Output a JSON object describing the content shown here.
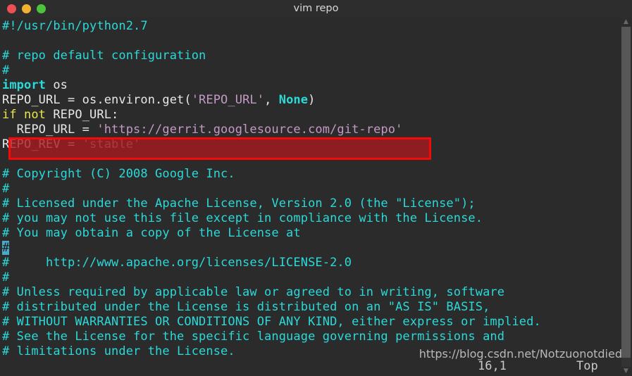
{
  "window": {
    "title": "vim repo",
    "traffic_lights": [
      {
        "name": "close",
        "color": "#ed4f54"
      },
      {
        "name": "minimize",
        "color": "#f0b132"
      },
      {
        "name": "maximize",
        "color": "#4cc43c"
      }
    ]
  },
  "editor": {
    "filename": "repo",
    "lines": [
      {
        "n": 1,
        "segments": [
          {
            "t": "#!/usr/bin/python2.7",
            "c": "comment"
          }
        ]
      },
      {
        "n": 2,
        "segments": [
          {
            "t": "",
            "c": "blank"
          }
        ]
      },
      {
        "n": 3,
        "segments": [
          {
            "t": "# repo default configuration",
            "c": "comment"
          }
        ]
      },
      {
        "n": 4,
        "segments": [
          {
            "t": "#",
            "c": "comment"
          }
        ]
      },
      {
        "n": 5,
        "segments": [
          {
            "t": "import",
            "c": "const"
          },
          {
            "t": " os",
            "c": "plain"
          }
        ]
      },
      {
        "n": 6,
        "segments": [
          {
            "t": "REPO_URL = os.environ.get(",
            "c": "plain"
          },
          {
            "t": "'REPO_URL'",
            "c": "string"
          },
          {
            "t": ", ",
            "c": "plain"
          },
          {
            "t": "None",
            "c": "const"
          },
          {
            "t": ")",
            "c": "plain"
          }
        ]
      },
      {
        "n": 7,
        "segments": [
          {
            "t": "if not",
            "c": "kw"
          },
          {
            "t": " REPO_URL:",
            "c": "plain"
          }
        ]
      },
      {
        "n": 8,
        "segments": [
          {
            "t": "  REPO_URL = ",
            "c": "plain"
          },
          {
            "t": "'https://gerrit.googlesource.com/git-repo'",
            "c": "string"
          }
        ]
      },
      {
        "n": 9,
        "segments": [
          {
            "t": "REPO_REV = ",
            "c": "plain"
          },
          {
            "t": "'stable'",
            "c": "string"
          }
        ]
      },
      {
        "n": 10,
        "segments": [
          {
            "t": "",
            "c": "blank"
          }
        ]
      },
      {
        "n": 11,
        "segments": [
          {
            "t": "# Copyright (C) 2008 Google Inc.",
            "c": "comment"
          }
        ]
      },
      {
        "n": 12,
        "segments": [
          {
            "t": "#",
            "c": "comment"
          }
        ]
      },
      {
        "n": 13,
        "segments": [
          {
            "t": "# Licensed under the Apache License, Version 2.0 (the \"License\");",
            "c": "comment"
          }
        ]
      },
      {
        "n": 14,
        "segments": [
          {
            "t": "# you may not use this file except in compliance with the License.",
            "c": "comment"
          }
        ]
      },
      {
        "n": 15,
        "segments": [
          {
            "t": "# You may obtain a copy of the License at",
            "c": "comment"
          }
        ]
      },
      {
        "n": 16,
        "segments": [
          {
            "t": "#",
            "c": "cursor"
          }
        ]
      },
      {
        "n": 17,
        "segments": [
          {
            "t": "#     http://www.apache.org/licenses/LICENSE-2.0",
            "c": "comment"
          }
        ]
      },
      {
        "n": 18,
        "segments": [
          {
            "t": "#",
            "c": "comment"
          }
        ]
      },
      {
        "n": 19,
        "segments": [
          {
            "t": "# Unless required by applicable law or agreed to in writing, software",
            "c": "comment"
          }
        ]
      },
      {
        "n": 20,
        "segments": [
          {
            "t": "# distributed under the License is distributed on an \"AS IS\" BASIS,",
            "c": "comment"
          }
        ]
      },
      {
        "n": 21,
        "segments": [
          {
            "t": "# WITHOUT WARRANTIES OR CONDITIONS OF ANY KIND, either express or implied.",
            "c": "comment"
          }
        ]
      },
      {
        "n": 22,
        "segments": [
          {
            "t": "# See the License for the specific language governing permissions and",
            "c": "comment"
          }
        ]
      },
      {
        "n": 23,
        "segments": [
          {
            "t": "# limitations under the License.",
            "c": "comment"
          }
        ]
      }
    ]
  },
  "annotation": {
    "type": "red-rectangle-highlight",
    "target_line": 8,
    "border_color": "#f50a0a",
    "fill_color": "#aa1a20"
  },
  "statusline": {
    "cursor_position": "16,1",
    "scroll_position": "Top"
  },
  "scrollbar": {
    "up_arrow": "▲",
    "down_arrow": "▼"
  },
  "watermark": {
    "text": "https://blog.csdn.net/Notzuonotdied"
  },
  "colors": {
    "background": "#2b2b2b",
    "titlebar": "#2d2d2d",
    "comment": "#2bd9d9",
    "plain": "#e8e8e8",
    "string": "#c49ac4",
    "keyword": "#e8e84a",
    "constant": "#2bd9d9",
    "cursor": "#4aa8c8"
  }
}
